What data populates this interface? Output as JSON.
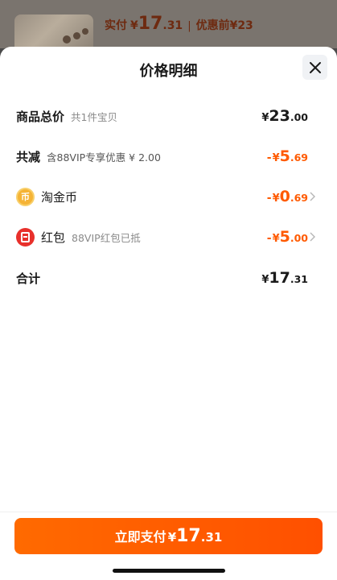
{
  "background": {
    "pay_label": "实付",
    "pay_currency": "¥",
    "pay_integer": "17",
    "pay_decimal": ".31",
    "separator": "|",
    "orig_label": "优惠前",
    "orig_value": "¥23"
  },
  "sheet": {
    "title": "价格明细",
    "close_icon": "close-icon"
  },
  "rows": {
    "total": {
      "label": "商品总价",
      "sub": "共1件宝贝",
      "currency": "¥",
      "integer": "23",
      "decimal": ".00"
    },
    "discount": {
      "label": "共减",
      "sub": "含88VIP专享优惠 ¥ 2.00",
      "minus": "-",
      "currency": "¥",
      "integer": "5",
      "decimal": ".69"
    },
    "coin": {
      "icon_text": "币",
      "label": "淘金币",
      "minus": "-",
      "currency": "¥",
      "integer": "0",
      "decimal": ".69"
    },
    "redpack": {
      "label": "红包",
      "sub": "88VIP红包已抵",
      "minus": "-",
      "currency": "¥",
      "integer": "5",
      "decimal": ".00"
    },
    "sum": {
      "label": "合计",
      "currency": "¥",
      "integer": "17",
      "decimal": ".31"
    }
  },
  "pay_button": {
    "label": "立即支付",
    "currency": "¥",
    "integer": "17",
    "decimal": ".31"
  },
  "colors": {
    "accent": "#ff5a00",
    "button": "#ff5000",
    "coin": "#f5b335",
    "redpack": "#e8302b"
  }
}
